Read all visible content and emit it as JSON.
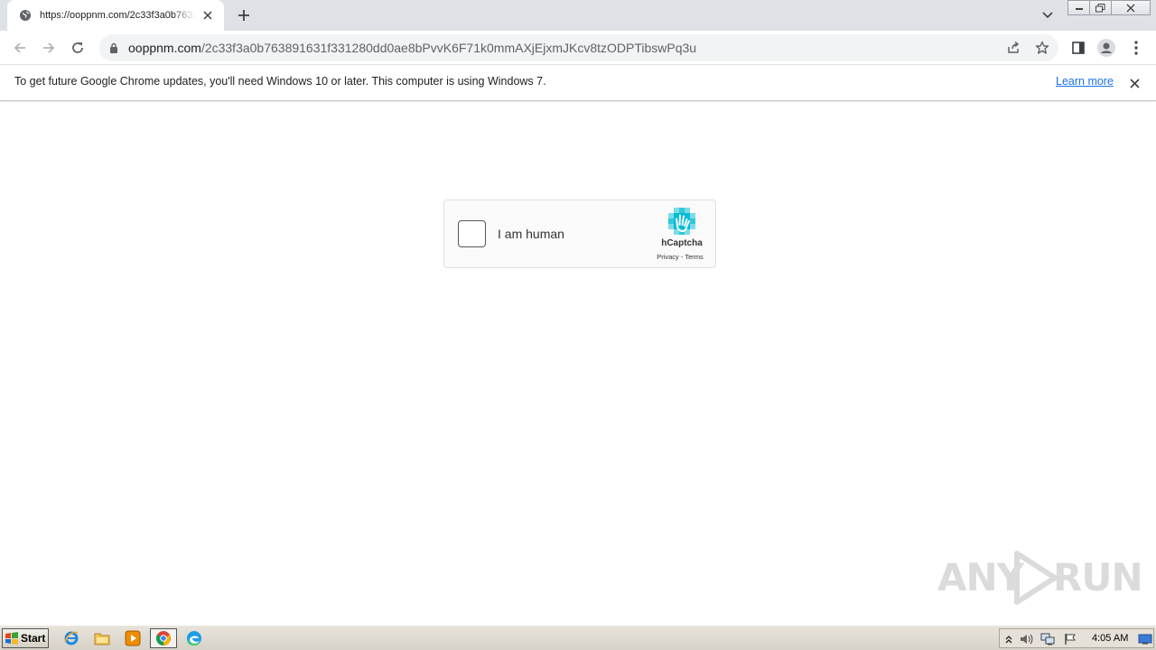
{
  "browser": {
    "tab": {
      "title": "https://ooppnm.com/2c33f3a0b763891631f331280dd0ae8bPvvK6F71k0mmAXjEjxmJKcv8tzODPTibswPq3u",
      "icon": "globe-icon"
    },
    "omnibox": {
      "host": "ooppnm.com",
      "path": "/2c33f3a0b763891631f331280dd0ae8bPvvK6F71k0mmAXjEjxmJKcv8tzODPTibswPq3u"
    },
    "infobar": {
      "message": "To get future Google Chrome updates, you'll need Windows 10 or later. This computer is using Windows 7.",
      "link": "Learn more"
    }
  },
  "captcha": {
    "label": "I am human",
    "brand": "hCaptcha",
    "links": "Privacy - Terms",
    "accent_color": "#00bcd4"
  },
  "watermark": {
    "text_left": "ANY",
    "text_right": "RUN"
  },
  "taskbar": {
    "start_label": "Start",
    "clock": "4:05 AM"
  }
}
